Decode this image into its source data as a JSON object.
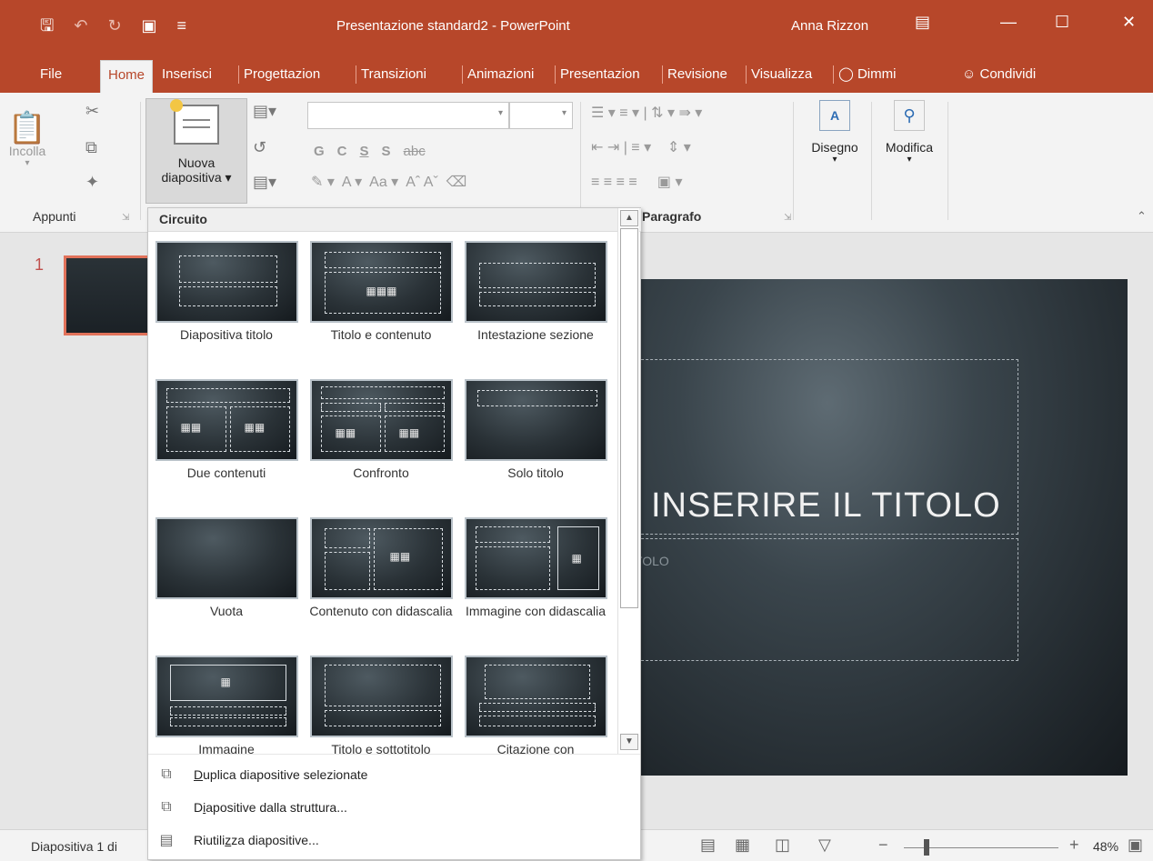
{
  "window": {
    "title": "Presentazione standard2  -  PowerPoint",
    "user": "Anna Rizzon"
  },
  "tabs": [
    "File",
    "Home",
    "Inserisci",
    "Progettazion",
    "Transizioni",
    "Animazioni",
    "Presentazion",
    "Revisione",
    "Visualizza",
    "Dimmi",
    "Condividi"
  ],
  "ribbon": {
    "paste_label": "Incolla",
    "new_slide_line1": "Nuova",
    "new_slide_line2": "diapositiva",
    "group_clipboard": "Appunti",
    "group_paragraph": "Paragrafo",
    "draw_label": "Disegno",
    "edit_label": "Modifica",
    "font_buttons": [
      "G",
      "C",
      "S",
      "S",
      "abc"
    ]
  },
  "dropdown": {
    "header": "Circuito",
    "layouts": [
      {
        "name": "Diapositiva titolo"
      },
      {
        "name": "Titolo e contenuto"
      },
      {
        "name": "Intestazione sezione"
      },
      {
        "name": "Due contenuti"
      },
      {
        "name": "Confronto"
      },
      {
        "name": "Solo titolo"
      },
      {
        "name": "Vuota"
      },
      {
        "name": "Contenuto con didascalia"
      },
      {
        "name": "Immagine con didascalia"
      },
      {
        "name": "Immagine"
      },
      {
        "name": "Titolo e sottotitolo"
      },
      {
        "name": "Citazione con"
      }
    ],
    "menu": [
      {
        "pre": "",
        "ul": "D",
        "post": "uplica diapositive selezionate"
      },
      {
        "pre": "D",
        "ul": "i",
        "post": "apositive dalla struttura..."
      },
      {
        "pre": "Riutili",
        "ul": "z",
        "post": "za diapositive..."
      }
    ]
  },
  "slides_panel": {
    "number": "1"
  },
  "slide": {
    "title": "INSERIRE IL TITOLO",
    "subtitle": "ITOLO"
  },
  "status": {
    "slide_info": "Diapositiva 1 di",
    "zoom": "48%"
  }
}
